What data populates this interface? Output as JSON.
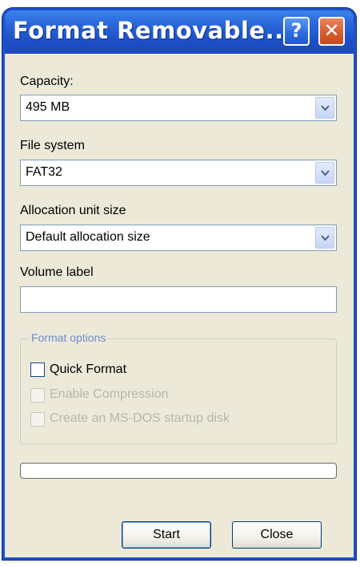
{
  "window": {
    "title": "Format Removable...",
    "help_glyph": "?",
    "close_glyph": "✕"
  },
  "capacity": {
    "label": "Capacity:",
    "value": "495 MB"
  },
  "file_system": {
    "label": "File system",
    "value": "FAT32"
  },
  "allocation": {
    "label": "Allocation unit size",
    "value": "Default allocation size"
  },
  "volume_label": {
    "label": "Volume label",
    "value": ""
  },
  "format_options": {
    "title": "Format options",
    "options": [
      {
        "label": "Quick Format",
        "checked": false,
        "enabled": true
      },
      {
        "label": "Enable Compression",
        "checked": false,
        "enabled": false
      },
      {
        "label": "Create an MS-DOS startup disk",
        "checked": false,
        "enabled": false
      }
    ]
  },
  "progress": {
    "value": 0
  },
  "buttons": {
    "start_label": "Start",
    "close_label": "Close"
  },
  "colors": {
    "titlebar": "#2a64d8",
    "dialog_background": "#ece9d8",
    "group_title": "#6e8ccc",
    "disabled_text": "#b8b6a8"
  },
  "icons": {
    "dropdown_arrow": "chevron-down-icon",
    "help": "help-icon",
    "close": "close-icon"
  }
}
